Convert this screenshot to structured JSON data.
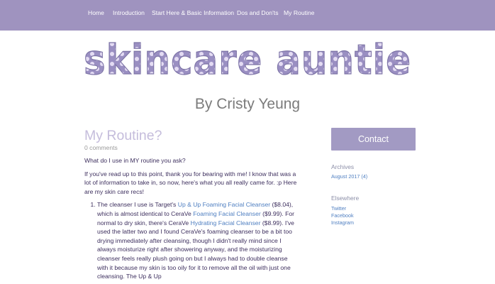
{
  "nav": {
    "items": [
      {
        "label": "Home"
      },
      {
        "label": "Introduction"
      },
      {
        "label": "Start Here & Basic Information"
      },
      {
        "label": "Dos and Don'ts"
      },
      {
        "label": "My Routine"
      }
    ]
  },
  "header": {
    "logo_text": "skincare auntie",
    "byline": "By Cristy Yeung"
  },
  "post": {
    "title": "My Routine?",
    "comments": "0 comments",
    "intro": "What do I use in MY routine you ask?",
    "para2": "If you've read up to this point, thank you for bearing with me! I know that was a lot of information to take in, so now, here's what you all really came for. :p Here are my skin care recs!",
    "item1": {
      "t1": "The cleanser I use is Target's ",
      "link1": "Up & Up Foaming Facial Cleanser",
      "t2": " ($8.04), which is almost identical to CeraVe ",
      "link2": "Foaming Facial Cleanser",
      "t3": " ($9.99). For normal to dry skin, there's CeraVe ",
      "link3": "Hydrating Facial Cleanser",
      "t4": " ($8.99). I've used the latter two and I found CeraVe's foaming cleanser to be a bit too drying immediately after cleansing, though I didn't really mind since I always moisturize right after showering anyway, and the moisturizing cleanser feels really plush going on but I always had to double cleanse with it because my skin is too oily for it to remove all the oil with just one cleansing. The Up & Up"
    }
  },
  "sidebar": {
    "contact_label": "Contact",
    "archives_heading": "Archives",
    "archives_link": "August 2017 (4)",
    "elsewhere_heading": "Elsewhere",
    "links": [
      "Twitter",
      "Facebook",
      "Instagram"
    ]
  },
  "colors": {
    "nav_bg": "#9f93bf",
    "logo_fill": "#9a8fc2",
    "logo_dots": "#e4dcf3",
    "title": "#c5bddc",
    "link": "#4f7fc1",
    "button_bg": "#a29ac3"
  }
}
